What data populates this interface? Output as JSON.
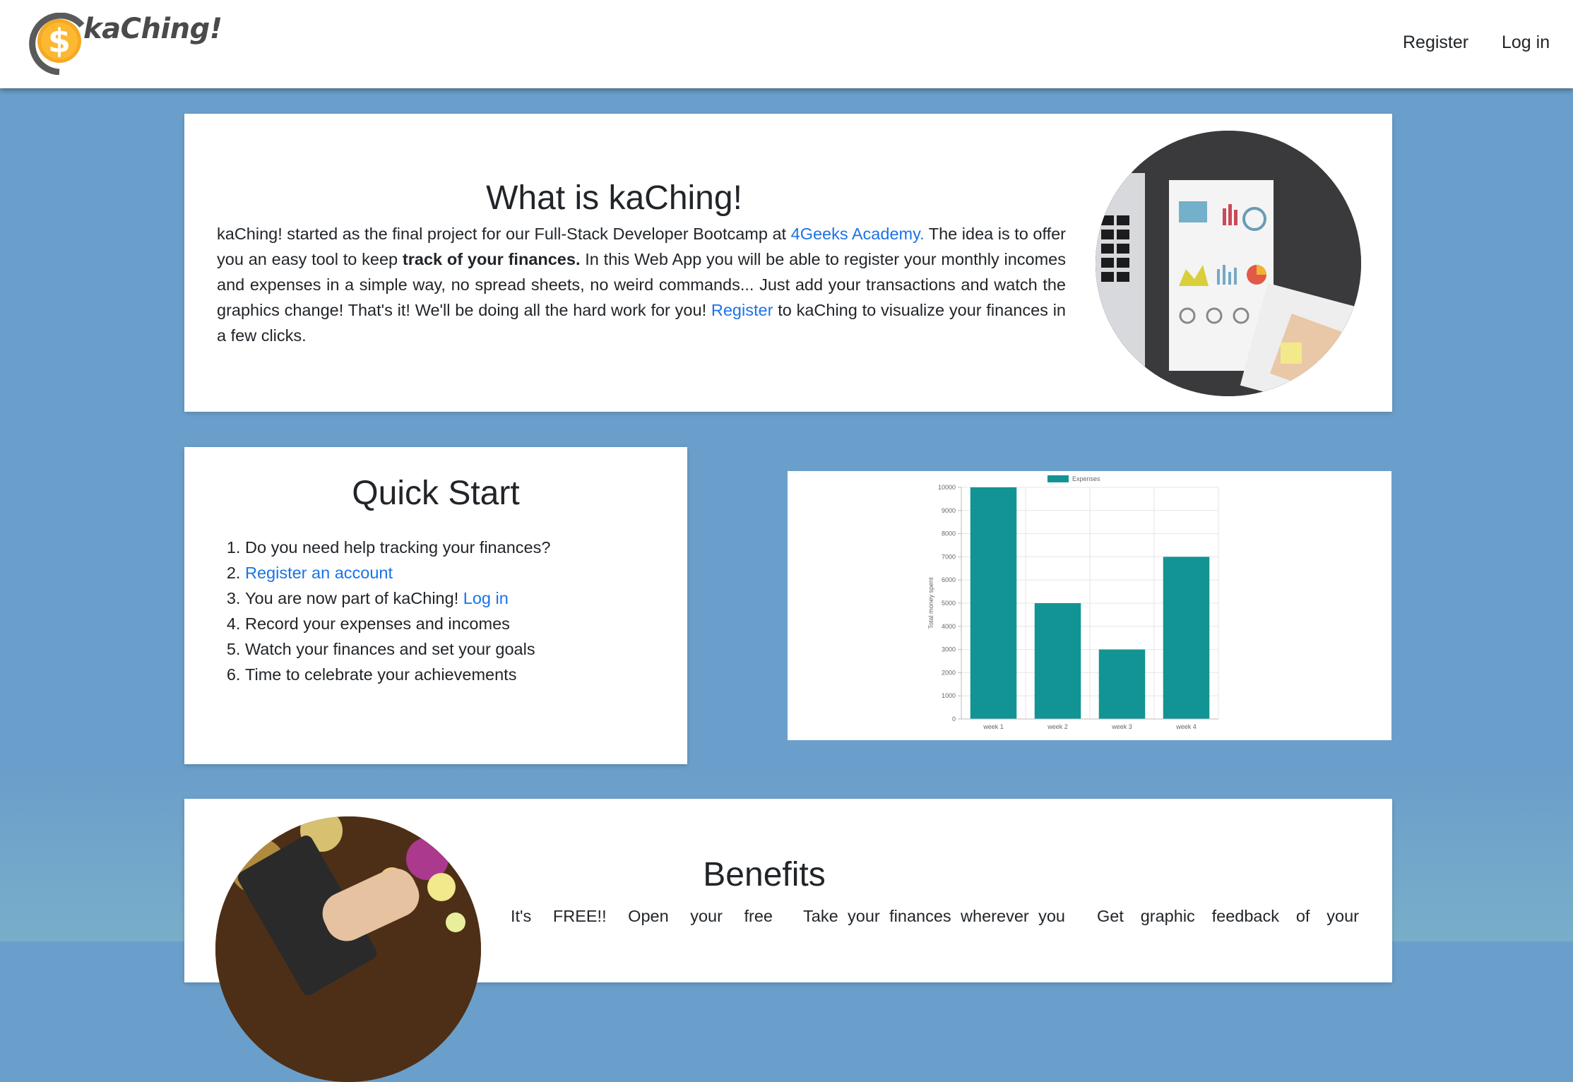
{
  "nav": {
    "brand": "kaChing!",
    "register": "Register",
    "login": "Log in"
  },
  "about": {
    "title": "What is kaChing!",
    "p1": "kaChing! started as the final project for our Full-Stack Developer Bootcamp at ",
    "academy_link": "4Geeks Academy.",
    "p2": " The idea is to offer you an easy tool to keep ",
    "bold": "track of your finances.",
    "p3": " In this Web App you will be able to register your monthly incomes and expenses in a simple way, no spread sheets, no weird commands... Just add your transactions and watch the graphics change! That's it! We'll be doing all the hard work for you! ",
    "register_link": "Register",
    "p4": " to kaChing to visualize your finances in a few clicks."
  },
  "quickstart": {
    "title": "Quick Start",
    "item1": "Do you need help tracking your finances?",
    "item2_link": "Register an account",
    "item3_text": "You are now part of kaChing! ",
    "item3_link": "Log in",
    "item4": "Record your expenses and incomes",
    "item5": "Watch your finances and set your goals",
    "item6": "Time to celebrate your achievements"
  },
  "chart_data": {
    "type": "bar",
    "categories": [
      "week 1",
      "week 2",
      "week 3",
      "week 4"
    ],
    "series": [
      {
        "name": "Expenses",
        "values": [
          10000,
          5000,
          3000,
          7000
        ]
      }
    ],
    "ylabel": "Total money spent",
    "ylim": [
      0,
      10000
    ],
    "yticks": [
      "0",
      "1000",
      "2000",
      "3000",
      "4000",
      "5000",
      "6000",
      "7000",
      "8000",
      "9000",
      "10000"
    ],
    "legend": "top",
    "grid": true,
    "color": "#139494"
  },
  "benefits": {
    "title": "Benefits",
    "col1": "It's FREE!! Open your free",
    "col2": "Take your finances wherever you",
    "col3": "Get graphic feedback of your"
  },
  "colors": {
    "background": "#6b9fcb",
    "link": "#1a73e8",
    "bar": "#139494"
  }
}
